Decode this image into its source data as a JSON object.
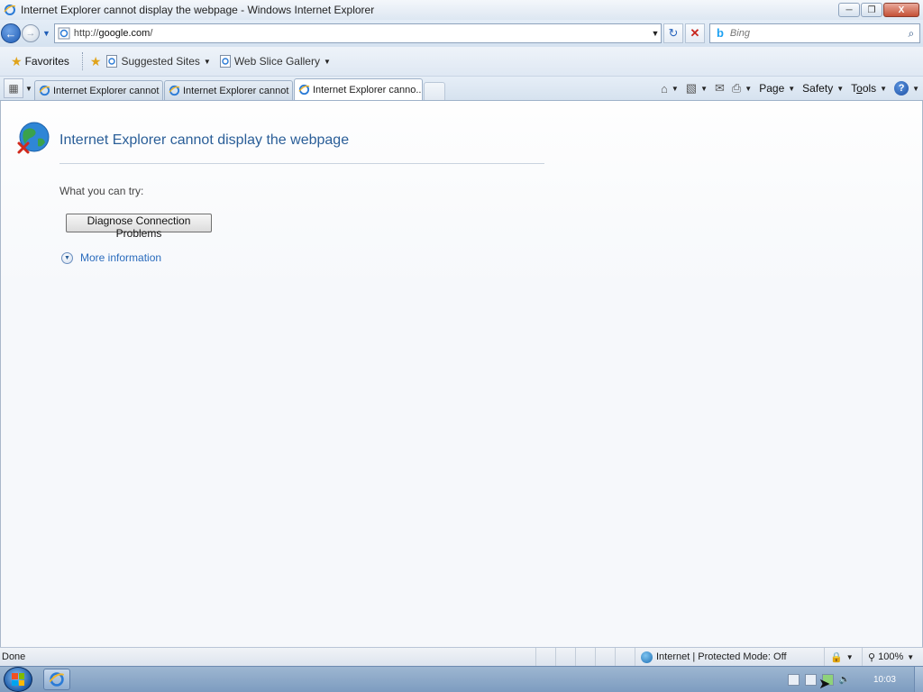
{
  "window": {
    "title": "Internet Explorer cannot display the webpage - Windows Internet Explorer",
    "minimize": "─",
    "restore": "❐",
    "close": "X"
  },
  "nav": {
    "back_glyph": "←",
    "forward_glyph": "→",
    "dropdown_glyph": "▼",
    "url_prefix": "http://",
    "url_host": "google.com",
    "url_suffix": "/",
    "refresh_glyph": "↻",
    "stop_glyph": "✕"
  },
  "search": {
    "placeholder": "Bing",
    "logo": "b",
    "button_glyph": "⌕"
  },
  "favorites_bar": {
    "favorites_label": "Favorites",
    "items": [
      {
        "label": "Suggested Sites"
      },
      {
        "label": "Web Slice Gallery"
      }
    ]
  },
  "tabs": [
    {
      "label": "Internet Explorer cannot di..."
    },
    {
      "label": "Internet Explorer cannot di..."
    },
    {
      "label": "Internet Explorer canno...",
      "active": true,
      "close": "X"
    }
  ],
  "command_bar": {
    "page": "Page",
    "safety": "Safety",
    "tools_prefix": "T",
    "tools_underline": "o",
    "tools_suffix": "ols",
    "help": "?"
  },
  "page": {
    "error_title": "Internet Explorer cannot display the webpage",
    "try_label": "What you can try:",
    "diagnose_button": "Diagnose Connection Problems",
    "more_info": "More information"
  },
  "statusbar": {
    "status": "Done",
    "zone": "Internet | Protected Mode: Off",
    "zoom": "100%"
  },
  "taskbar": {
    "clock": "10:03"
  },
  "colors": {
    "title_blue": "#2a5e98",
    "link_blue": "#2a6bbd"
  }
}
